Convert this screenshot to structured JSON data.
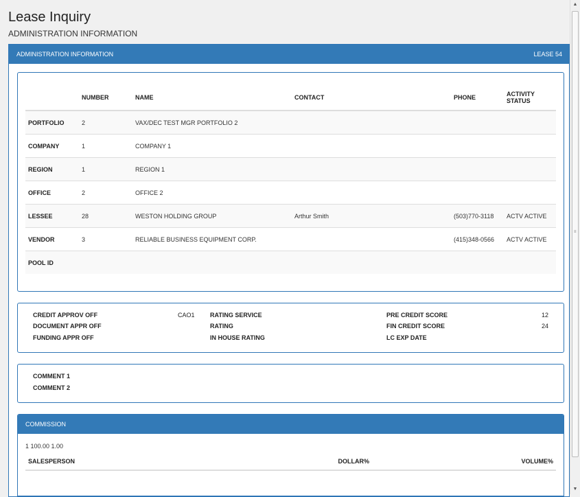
{
  "page": {
    "title": "Lease Inquiry",
    "subtitle": "ADMINISTRATION INFORMATION"
  },
  "panel": {
    "header": "ADMINISTRATION INFORMATION",
    "lease": "LEASE 54"
  },
  "admin_table": {
    "headers": [
      "",
      "NUMBER",
      "NAME",
      "CONTACT",
      "PHONE",
      "ACTIVITY STATUS"
    ],
    "rows": [
      {
        "label": "PORTFOLIO",
        "number": "2",
        "name": "VAX/DEC TEST MGR PORTFOLIO 2",
        "contact": "",
        "phone": "",
        "status": ""
      },
      {
        "label": "COMPANY",
        "number": "1",
        "name": "COMPANY 1",
        "contact": "",
        "phone": "",
        "status": ""
      },
      {
        "label": "REGION",
        "number": "1",
        "name": "REGION 1",
        "contact": "",
        "phone": "",
        "status": ""
      },
      {
        "label": "OFFICE",
        "number": "2",
        "name": "OFFICE 2",
        "contact": "",
        "phone": "",
        "status": ""
      },
      {
        "label": "LESSEE",
        "number": "28",
        "name": "WESTON HOLDING GROUP",
        "contact": "Arthur Smith",
        "phone": "(503)770-3118",
        "status": "ACTV ACTIVE"
      },
      {
        "label": "VENDOR",
        "number": "3",
        "name": "RELIABLE BUSINESS EQUIPMENT CORP.",
        "contact": "",
        "phone": "(415)348-0566",
        "status": "ACTV ACTIVE"
      },
      {
        "label": "POOL ID",
        "number": "",
        "name": "",
        "contact": "",
        "phone": "",
        "status": ""
      }
    ]
  },
  "credit": {
    "rows": [
      {
        "label1": "CREDIT APPROV OFF",
        "value1": "CAO1",
        "label2": "RATING SERVICE",
        "label3": "PRE CREDIT SCORE",
        "value3": "12"
      },
      {
        "label1": "DOCUMENT APPR OFF",
        "value1": "",
        "label2": "RATING",
        "label3": "FIN CREDIT SCORE",
        "value3": "24"
      },
      {
        "label1": "FUNDING APPR OFF",
        "value1": "",
        "label2": "IN HOUSE RATING",
        "label3": "LC EXP DATE",
        "value3": ""
      }
    ]
  },
  "comments": {
    "comment1": "COMMENT 1",
    "comment2": "COMMENT 2"
  },
  "commission": {
    "header": "COMMISSION",
    "values_line": "1 100.00 1.00",
    "columns": [
      "SALESPERSON",
      "DOLLAR%",
      "VOLUME%"
    ]
  },
  "scrollbar": {
    "up_icon": "scroll-up-arrow",
    "down_icon": "scroll-down-arrow"
  },
  "colors": {
    "accent": "#337ab7",
    "border": "#2e75b6",
    "background": "#f0f0f0"
  }
}
